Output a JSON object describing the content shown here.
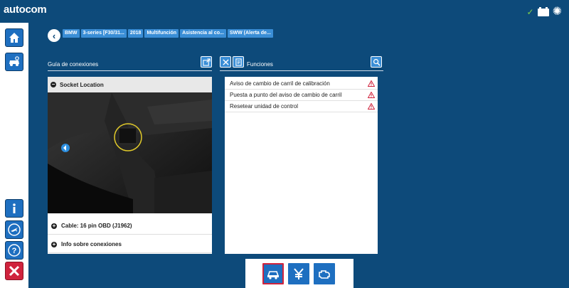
{
  "app": {
    "logo_text": "autocom"
  },
  "breadcrumb": [
    "BMW",
    "3-series [F30/31...",
    "2018",
    "Multifunción",
    "Asistencia al co...",
    "SWW (Alerta de..."
  ],
  "connection_guide": {
    "title": "Guía de conexiones",
    "socket_location_label": "Socket Location",
    "cable_label": "Cable: 16 pin OBD (J1962)",
    "info_label": "Info sobre conexiones"
  },
  "functions": {
    "title": "Funciones",
    "items": [
      "Aviso de cambio de carril de calibración",
      "Puesta a punto del aviso de cambio de carril",
      "Resetear unidad de control"
    ]
  },
  "colors": {
    "background": "#0d4a7a",
    "button_blue": "#1e6fc0",
    "crumb_blue": "#3a8ed6",
    "warning_red": "#d0233d",
    "status_green": "#7fd14b"
  },
  "icons": {
    "top": [
      "check-icon",
      "battery-icon",
      "gear-icon"
    ],
    "sidebar": [
      "home-icon",
      "car-settings-icon",
      "info-icon",
      "plane-icon",
      "help-icon",
      "close-icon"
    ],
    "bottom_tabs": [
      "car-diagnostic-icon",
      "currency-icon",
      "engine-icon"
    ]
  }
}
